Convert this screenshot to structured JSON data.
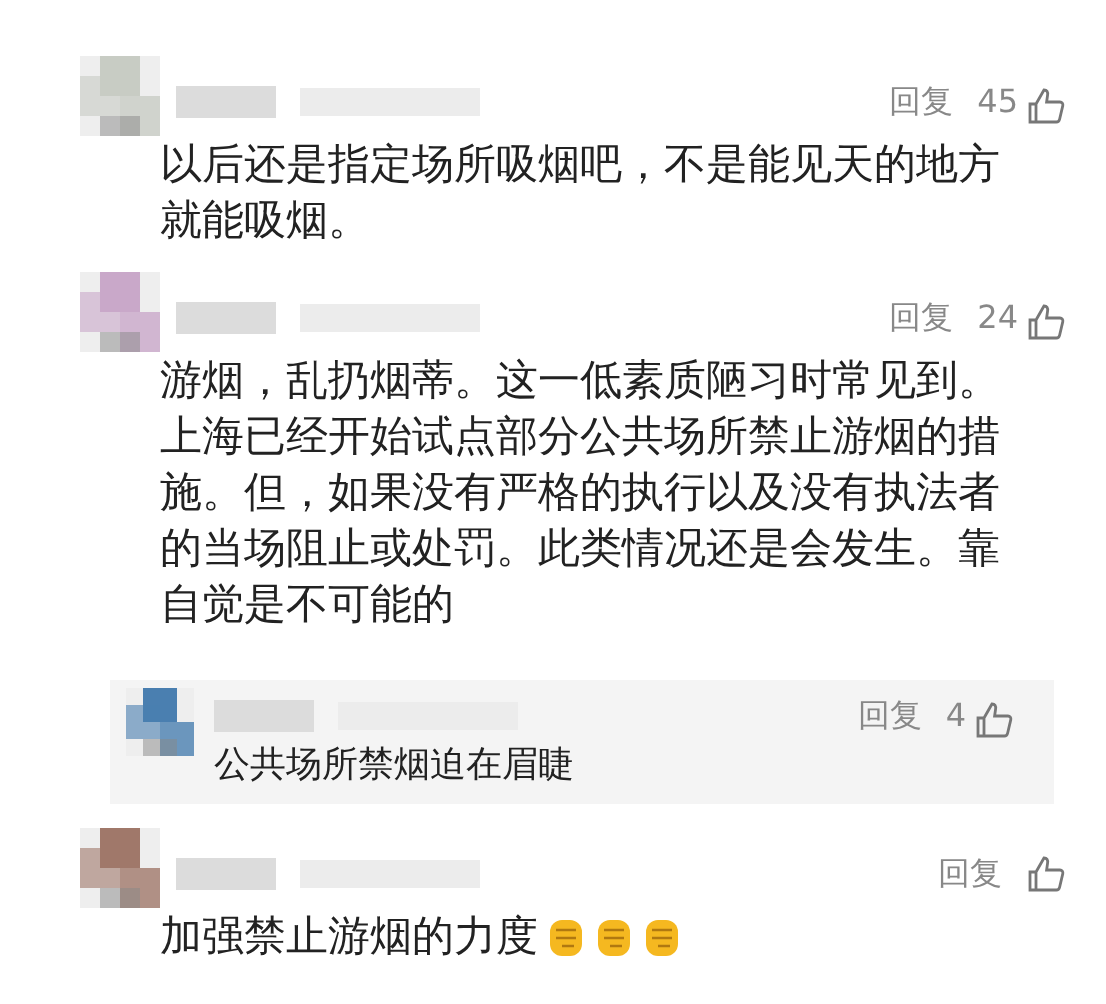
{
  "comments": [
    {
      "color": "#c8ccc4",
      "reply_label": "回复",
      "likes": "45",
      "text": "以后还是指定场所吸烟吧，不是能见天的地方就能吸烟。"
    },
    {
      "color": "#c9a8c9",
      "reply_label": "回复",
      "likes": "24",
      "text": "游烟，乱扔烟蒂。这一低素质陋习时常见到。上海已经开始试点部分公共场所禁止游烟的措施。但，如果没有严格的执行以及没有执法者的当场阻止或处罚。此类情况还是会发生。靠自觉是不可能的",
      "replies": [
        {
          "color": "#4a7fb0",
          "reply_label": "回复",
          "likes": "4",
          "text": "公共场所禁烟迫在眉睫"
        }
      ]
    },
    {
      "color": "#a0786a",
      "reply_label": "回复",
      "text": "加强禁止游烟的力度",
      "emojis": [
        {
          "kind": "fist"
        },
        {
          "kind": "fist"
        },
        {
          "kind": "fist"
        }
      ]
    }
  ]
}
